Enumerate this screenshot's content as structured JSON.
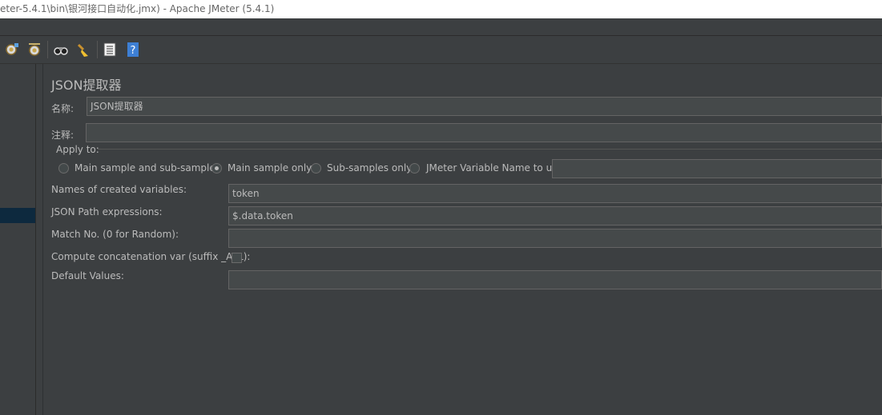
{
  "window": {
    "title": "eter-5.4.1\\bin\\银河接口自动化.jmx) - Apache JMeter (5.4.1)"
  },
  "toolbar": {
    "icons": [
      "start-no-pauses-icon",
      "start-no-timers-icon",
      "search-icon",
      "clear-all-icon",
      "function-helper-icon",
      "help-icon"
    ]
  },
  "panel": {
    "heading": "JSON提取器",
    "name_label": "名称:",
    "name_value": "JSON提取器",
    "comment_label": "注释:",
    "comment_value": "",
    "apply_to": {
      "label": "Apply to:",
      "options": [
        {
          "label": "Main sample and sub-samples",
          "checked": false
        },
        {
          "label": "Main sample only",
          "checked": true
        },
        {
          "label": "Sub-samples only",
          "checked": false
        },
        {
          "label": "JMeter Variable Name to use",
          "checked": false
        }
      ],
      "variable_name_value": ""
    },
    "fields": {
      "names_label": "Names of created variables:",
      "names_value": "token",
      "jsonpath_label": "JSON Path expressions:",
      "jsonpath_value": "$.data.token",
      "match_label": "Match No. (0 for Random):",
      "match_value": "",
      "concat_label": "Compute concatenation var (suffix _ALL):",
      "concat_checked": false,
      "default_label": "Default Values:",
      "default_value": ""
    }
  },
  "colors": {
    "background": "#3c3f41",
    "field_bg": "#45494a",
    "text": "#bbbbbb",
    "selection": "#0d293e"
  }
}
